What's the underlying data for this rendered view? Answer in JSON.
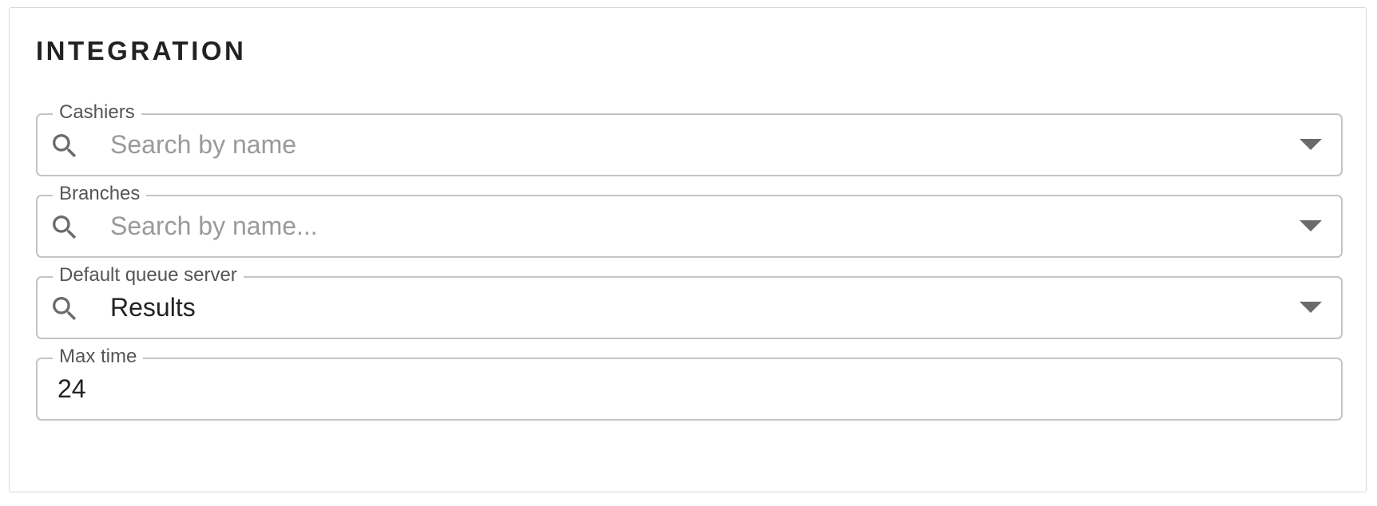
{
  "section": {
    "title": "INTEGRATION"
  },
  "fields": {
    "cashiers": {
      "label": "Cashiers",
      "placeholder": "Search by name",
      "value": ""
    },
    "branches": {
      "label": "Branches",
      "placeholder": "Search by name...",
      "value": ""
    },
    "default_queue_server": {
      "label": "Default queue server",
      "placeholder": "",
      "value": "Results"
    },
    "max_time": {
      "label": "Max time",
      "value": "24"
    }
  },
  "icons": {
    "search": "search-icon",
    "dropdown": "chevron-down-icon"
  },
  "colors": {
    "border": "#c4c4c4",
    "label": "#555555",
    "placeholder": "#9a9a9a",
    "text": "#222222",
    "icon": "#6b6b6b"
  }
}
